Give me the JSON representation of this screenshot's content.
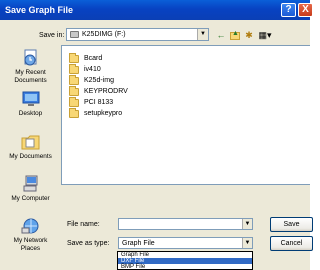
{
  "window": {
    "title": "Save Graph File",
    "help_glyph": "?",
    "close_glyph": "X"
  },
  "toolbar": {
    "save_in_label": "Save in:",
    "save_in_value": "K25DIMG (F:)",
    "back_glyph": "←",
    "up_glyph": "▲",
    "new_folder_glyph": "✱",
    "views_glyph": "▦▾"
  },
  "places": [
    {
      "label": "My Recent Documents",
      "icon": "recent-documents-icon"
    },
    {
      "label": "Desktop",
      "icon": "desktop-icon"
    },
    {
      "label": "My Documents",
      "icon": "my-documents-icon"
    },
    {
      "label": "My Computer",
      "icon": "my-computer-icon"
    },
    {
      "label": "My Network Places",
      "icon": "network-places-icon"
    }
  ],
  "files": [
    "Bcard",
    "iv410",
    "K25d-img",
    "KEYPRODRV",
    "PCI 8133",
    "setupkeypro"
  ],
  "footer": {
    "file_name_label": "File name:",
    "file_name_value": "",
    "save_as_type_label": "Save as type:",
    "save_as_type_value": "Graph File",
    "save_button": "Save",
    "cancel_button": "Cancel"
  },
  "type_options": [
    {
      "label": "Graph File",
      "selected": false
    },
    {
      "label": "DXF File",
      "selected": true
    },
    {
      "label": "BMP File",
      "selected": false
    }
  ],
  "colors": {
    "titlebar": "#0842c2",
    "selection": "#316ac5",
    "dialog": "#ece9d8",
    "folder": "#f8d775"
  }
}
